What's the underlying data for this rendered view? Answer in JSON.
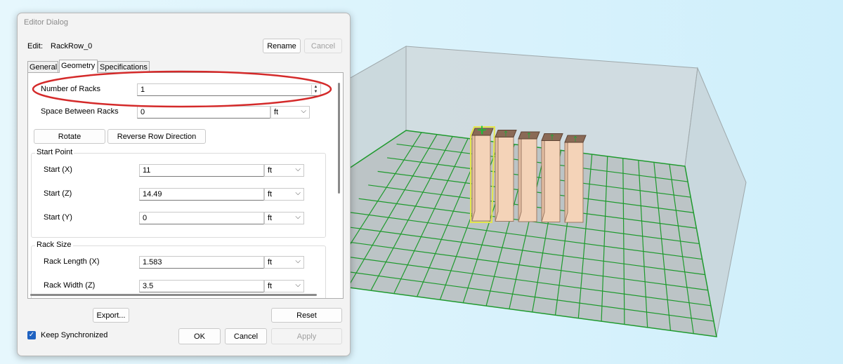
{
  "dialog": {
    "title": "Editor Dialog",
    "edit_label": "Edit:",
    "edit_value": "RackRow_0",
    "rename_label": "Rename",
    "cancel_top_label": "Cancel",
    "tabs": [
      {
        "label": "General"
      },
      {
        "label": "Geometry"
      },
      {
        "label": "Specifications"
      }
    ],
    "geometry": {
      "number_of_racks_label": "Number of Racks",
      "number_of_racks_value": "1",
      "space_between_label": "Space Between Racks",
      "space_between_value": "0",
      "space_between_unit": "ft",
      "rotate_label": "Rotate",
      "reverse_label": "Reverse Row Direction",
      "start_point": {
        "title": "Start Point",
        "x_label": "Start (X)",
        "x_value": "11",
        "x_unit": "ft",
        "z_label": "Start (Z)",
        "z_value": "14.49",
        "z_unit": "ft",
        "y_label": "Start (Y)",
        "y_value": "0",
        "y_unit": "ft"
      },
      "rack_size": {
        "title": "Rack Size",
        "length_label": "Rack Length (X)",
        "length_value": "1.583",
        "length_unit": "ft",
        "width_label": "Rack Width (Z)",
        "width_value": "3.5",
        "width_unit": "ft"
      }
    },
    "export_label": "Export...",
    "reset_label": "Reset",
    "keep_sync_label": "Keep Synchronized",
    "keep_sync_checked": true,
    "ok_label": "OK",
    "cancel_label": "Cancel",
    "apply_label": "Apply"
  },
  "scene": {
    "rack_count": 5,
    "selected_rack": 1,
    "colors": {
      "sky": "#d6f2fc",
      "room_wall": "#cfd9dc",
      "floor": "#c2c9cb",
      "grid": "#1f9a2e",
      "rack_front": "#f4d3b8",
      "rack_top": "#8a6a56",
      "selection": "#e4e64c",
      "arrow": "#27a33a",
      "highlight_ellipse": "#d42a2a"
    }
  }
}
